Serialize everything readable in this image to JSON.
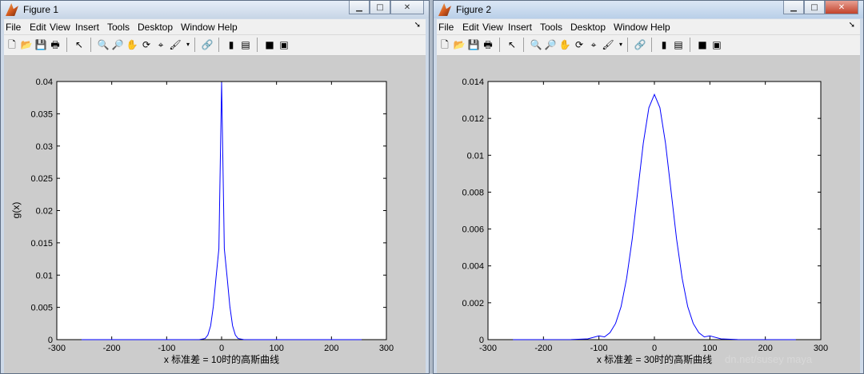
{
  "windows": [
    {
      "title": "Figure 1",
      "menu": [
        "File",
        "Edit",
        "View",
        "Insert",
        "Tools",
        "Desktop",
        "Window",
        "Help"
      ],
      "plot": {
        "xlabel": "x 标准差 = 10时的高斯曲线",
        "ylabel": "g(x)",
        "xticks": [
          "-300",
          "-200",
          "-100",
          "0",
          "100",
          "200",
          "300"
        ],
        "yticks": [
          "0",
          "0.005",
          "0.01",
          "0.015",
          "0.02",
          "0.025",
          "0.03",
          "0.035",
          "0.04"
        ]
      }
    },
    {
      "title": "Figure 2",
      "menu": [
        "File",
        "Edit",
        "View",
        "Insert",
        "Tools",
        "Desktop",
        "Window",
        "Help"
      ],
      "plot": {
        "xlabel": "x 标准差 = 30时的高斯曲线",
        "ylabel": "",
        "xticks": [
          "-300",
          "-200",
          "-100",
          "0",
          "100",
          "200",
          "300"
        ],
        "yticks": [
          "0",
          "0.002",
          "0.004",
          "0.006",
          "0.008",
          "0.01",
          "0.012",
          "0.014"
        ]
      }
    }
  ],
  "watermark": "dn.net/susey maya",
  "colors": {
    "line": "#0000ff",
    "plot_bg": "#ffffff",
    "figure_bg": "#cccccc"
  },
  "chart_data": [
    {
      "type": "line",
      "title": "",
      "xlabel": "x 标准差 = 10时的高斯曲线",
      "ylabel": "g(x)",
      "xlim": [
        -300,
        300
      ],
      "ylim": [
        0,
        0.04
      ],
      "grid": false,
      "series": [
        {
          "x": [
            -255,
            -100,
            -60,
            -40,
            -30,
            -25,
            -20,
            -15,
            -10,
            -5,
            0,
            5,
            10,
            15,
            20,
            25,
            30,
            40,
            60,
            100,
            255
          ],
          "values": [
            0,
            0,
            0,
            1.8e-05,
            0.000175,
            0.0007,
            0.00216,
            0.00518,
            0.00968,
            0.01408,
            0.03989,
            0.01408,
            0.00968,
            0.00518,
            0.00216,
            0.0007,
            0.000175,
            1.8e-05,
            0,
            0,
            0
          ]
        }
      ]
    },
    {
      "type": "line",
      "title": "",
      "xlabel": "x 标准差 = 30时的高斯曲线",
      "ylabel": "",
      "xlim": [
        -300,
        300
      ],
      "ylim": [
        0,
        0.014
      ],
      "grid": false,
      "series": [
        {
          "x": [
            -255,
            -150,
            -120,
            -100,
            -90,
            -80,
            -70,
            -60,
            -50,
            -40,
            -30,
            -20,
            -10,
            0,
            10,
            20,
            30,
            40,
            50,
            60,
            70,
            80,
            90,
            100,
            120,
            150,
            255
          ],
          "values": [
            0,
            4.9e-06,
            4.5e-05,
            0.000205,
            0.000148,
            0.000379,
            0.00088,
            0.001799,
            0.003329,
            0.005467,
            0.008066,
            0.010648,
            0.01258,
            0.013298,
            0.01258,
            0.010648,
            0.008066,
            0.005467,
            0.003329,
            0.001799,
            0.00088,
            0.000379,
            0.000148,
            0.000205,
            4.5e-05,
            4.9e-06,
            0
          ]
        }
      ]
    }
  ]
}
